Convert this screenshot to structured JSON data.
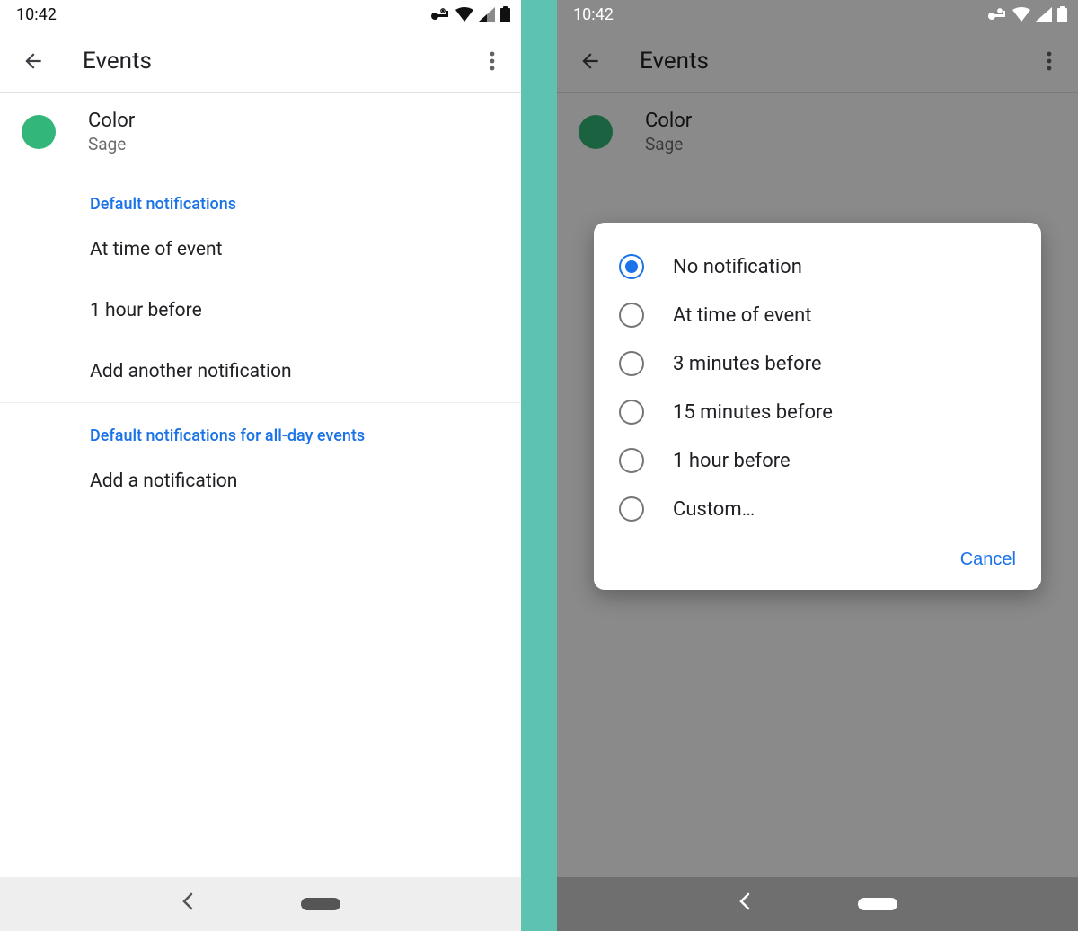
{
  "status": {
    "time": "10:42"
  },
  "left": {
    "title": "Events",
    "color_row": {
      "label": "Color",
      "value": "Sage",
      "swatch": "#33b679"
    },
    "sections": [
      {
        "label": "Default notifications",
        "items": [
          "At time of event",
          "1 hour before",
          "Add another notification"
        ],
        "divider_after": true
      },
      {
        "label": "Default notifications for all-day events",
        "items": [
          "Add a notification"
        ],
        "divider_after": false
      }
    ]
  },
  "right": {
    "title": "Events",
    "color_row": {
      "label": "Color",
      "value": "Sage",
      "swatch": "#33b679"
    },
    "dialog": {
      "options": [
        {
          "label": "No notification",
          "selected": true
        },
        {
          "label": "At time of event",
          "selected": false
        },
        {
          "label": "3 minutes before",
          "selected": false
        },
        {
          "label": "15 minutes before",
          "selected": false
        },
        {
          "label": "1 hour before",
          "selected": false
        },
        {
          "label": "Custom…",
          "selected": false
        }
      ],
      "cancel": "Cancel"
    }
  }
}
